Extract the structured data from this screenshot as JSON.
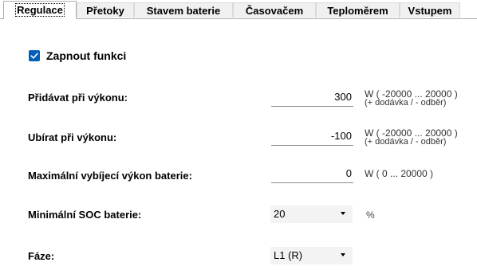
{
  "tabs": [
    {
      "label": "Regulace",
      "active": true
    },
    {
      "label": "Přetoky",
      "active": false
    },
    {
      "label": "Stavem baterie",
      "active": false
    },
    {
      "label": "Časovačem",
      "active": false
    },
    {
      "label": "Teploměrem",
      "active": false
    },
    {
      "label": "Vstupem",
      "active": false
    }
  ],
  "enable": {
    "label": "Zapnout funkci",
    "checked": true,
    "check_color": "#005fb8"
  },
  "add_power": {
    "label": "Přidávat při výkonu:",
    "value": "300",
    "unit_line1": "W ( -20000  ... 20000 )",
    "unit_line2": "(+ dodávka / - odběr)"
  },
  "remove_power": {
    "label": "Ubírat při výkonu:",
    "value": "-100",
    "unit_line1": "W ( -20000  ... 20000 )",
    "unit_line2": "(+ dodávka / - odběr)"
  },
  "max_discharge": {
    "label": "Maximální vybíjecí výkon baterie:",
    "value": "0",
    "unit": "W ( 0 ... 20000 )"
  },
  "min_soc": {
    "label": "Minimální SOC baterie:",
    "selected": "20",
    "unit": "%"
  },
  "phase": {
    "label": "Fáze:",
    "selected": "L1 (R)"
  }
}
